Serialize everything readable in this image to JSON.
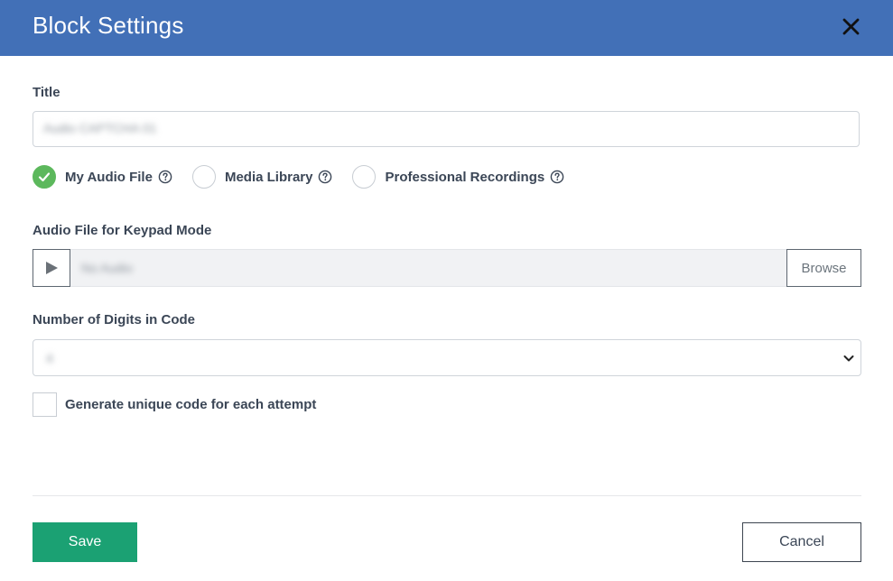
{
  "header": {
    "title": "Block Settings",
    "close_icon": "close-icon"
  },
  "form": {
    "title_label": "Title",
    "title_value": "Audio CAPTCHA 01",
    "audio_source": {
      "options": [
        {
          "label": "My Audio File",
          "selected": true
        },
        {
          "label": "Media Library",
          "selected": false
        },
        {
          "label": "Professional Recordings",
          "selected": false
        }
      ],
      "help_icon": "question-circle-icon"
    },
    "audio_file_label": "Audio File for Keypad Mode",
    "audio_file_value": "No Audio",
    "browse_label": "Browse",
    "digits_label": "Number of Digits in Code",
    "digits_value": "4",
    "unique_code_label": "Generate unique code for each attempt",
    "unique_code_checked": false
  },
  "footer": {
    "save_label": "Save",
    "cancel_label": "Cancel"
  },
  "colors": {
    "header_bg": "#4270b7",
    "save_bg": "#1ba173",
    "radio_checked": "#5cb85c"
  }
}
